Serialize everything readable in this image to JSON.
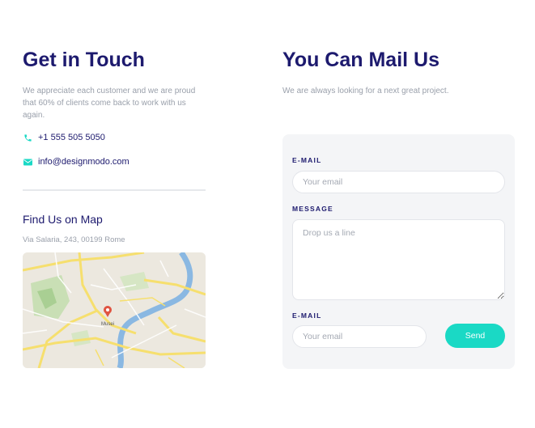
{
  "contact": {
    "title": "Get in Touch",
    "description": "We appreciate each customer and we are proud that 60% of clients come back to work with us again.",
    "phone": "+1 555 505 5050",
    "email": "info@designmodo.com",
    "phone_icon": "phone-icon",
    "email_icon": "envelope-icon"
  },
  "map_section": {
    "title": "Find Us on Map",
    "address": "Via Salaria, 243, 00199 Rome",
    "labels": [
      "Musei"
    ]
  },
  "mail": {
    "title": "You Can Mail Us",
    "description": "We are always looking for a next great project.",
    "form": {
      "email_label": "E-MAIL",
      "email_placeholder": "Your email",
      "message_label": "MESSAGE",
      "message_placeholder": "Drop us a line",
      "email2_label": "E-MAIL",
      "email2_placeholder": "Your email",
      "send_label": "Send"
    }
  },
  "colors": {
    "heading": "#1d1a6e",
    "muted": "#9aa0ab",
    "accent": "#1ad9c5",
    "panel": "#f4f5f7"
  }
}
